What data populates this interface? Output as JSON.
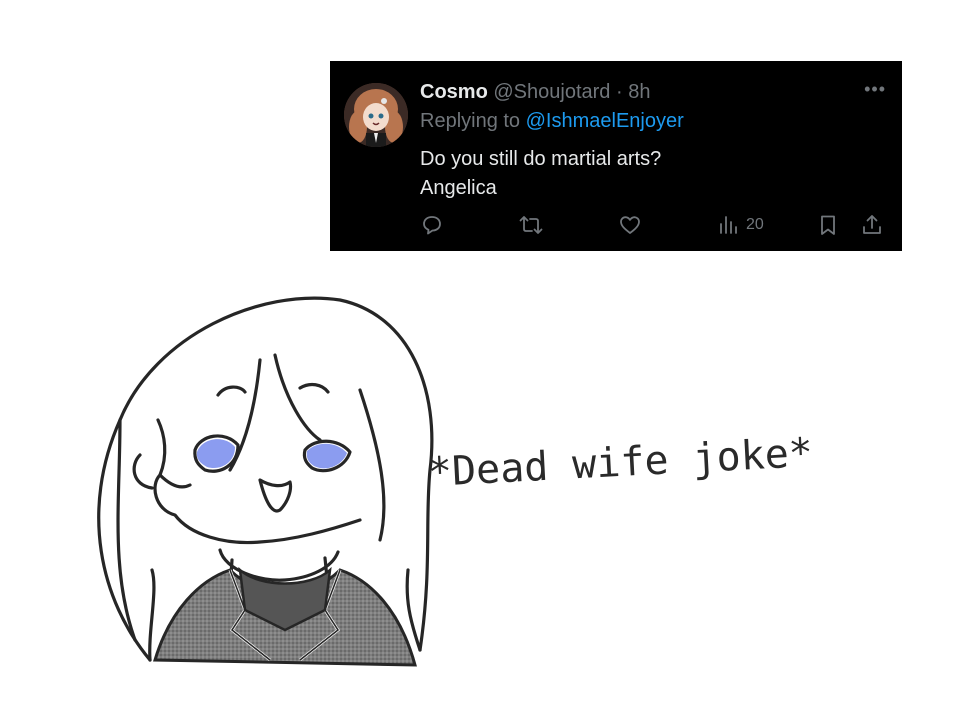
{
  "tweet": {
    "display_name": "Cosmo",
    "handle": "@Shoujotard",
    "separator": "·",
    "time": "8h",
    "more_label": "•••",
    "replying_prefix": "Replying to",
    "replying_to": "@IshmaelEnjoyer",
    "lines": [
      "Do you still do martial arts?",
      "Angelica"
    ],
    "actions": {
      "reply_icon": "reply-icon",
      "retweet_icon": "retweet-icon",
      "like_icon": "heart-icon",
      "views_icon": "views-icon",
      "views_count": "20",
      "bookmark_icon": "bookmark-icon",
      "share_icon": "share-icon"
    },
    "colors": {
      "background": "#000000",
      "text": "#e7e9ea",
      "muted": "#71767b",
      "link": "#1d9bf0"
    }
  },
  "drawing": {
    "caption": "*Dead wife joke*",
    "eye_color": "#8b9cf0"
  }
}
